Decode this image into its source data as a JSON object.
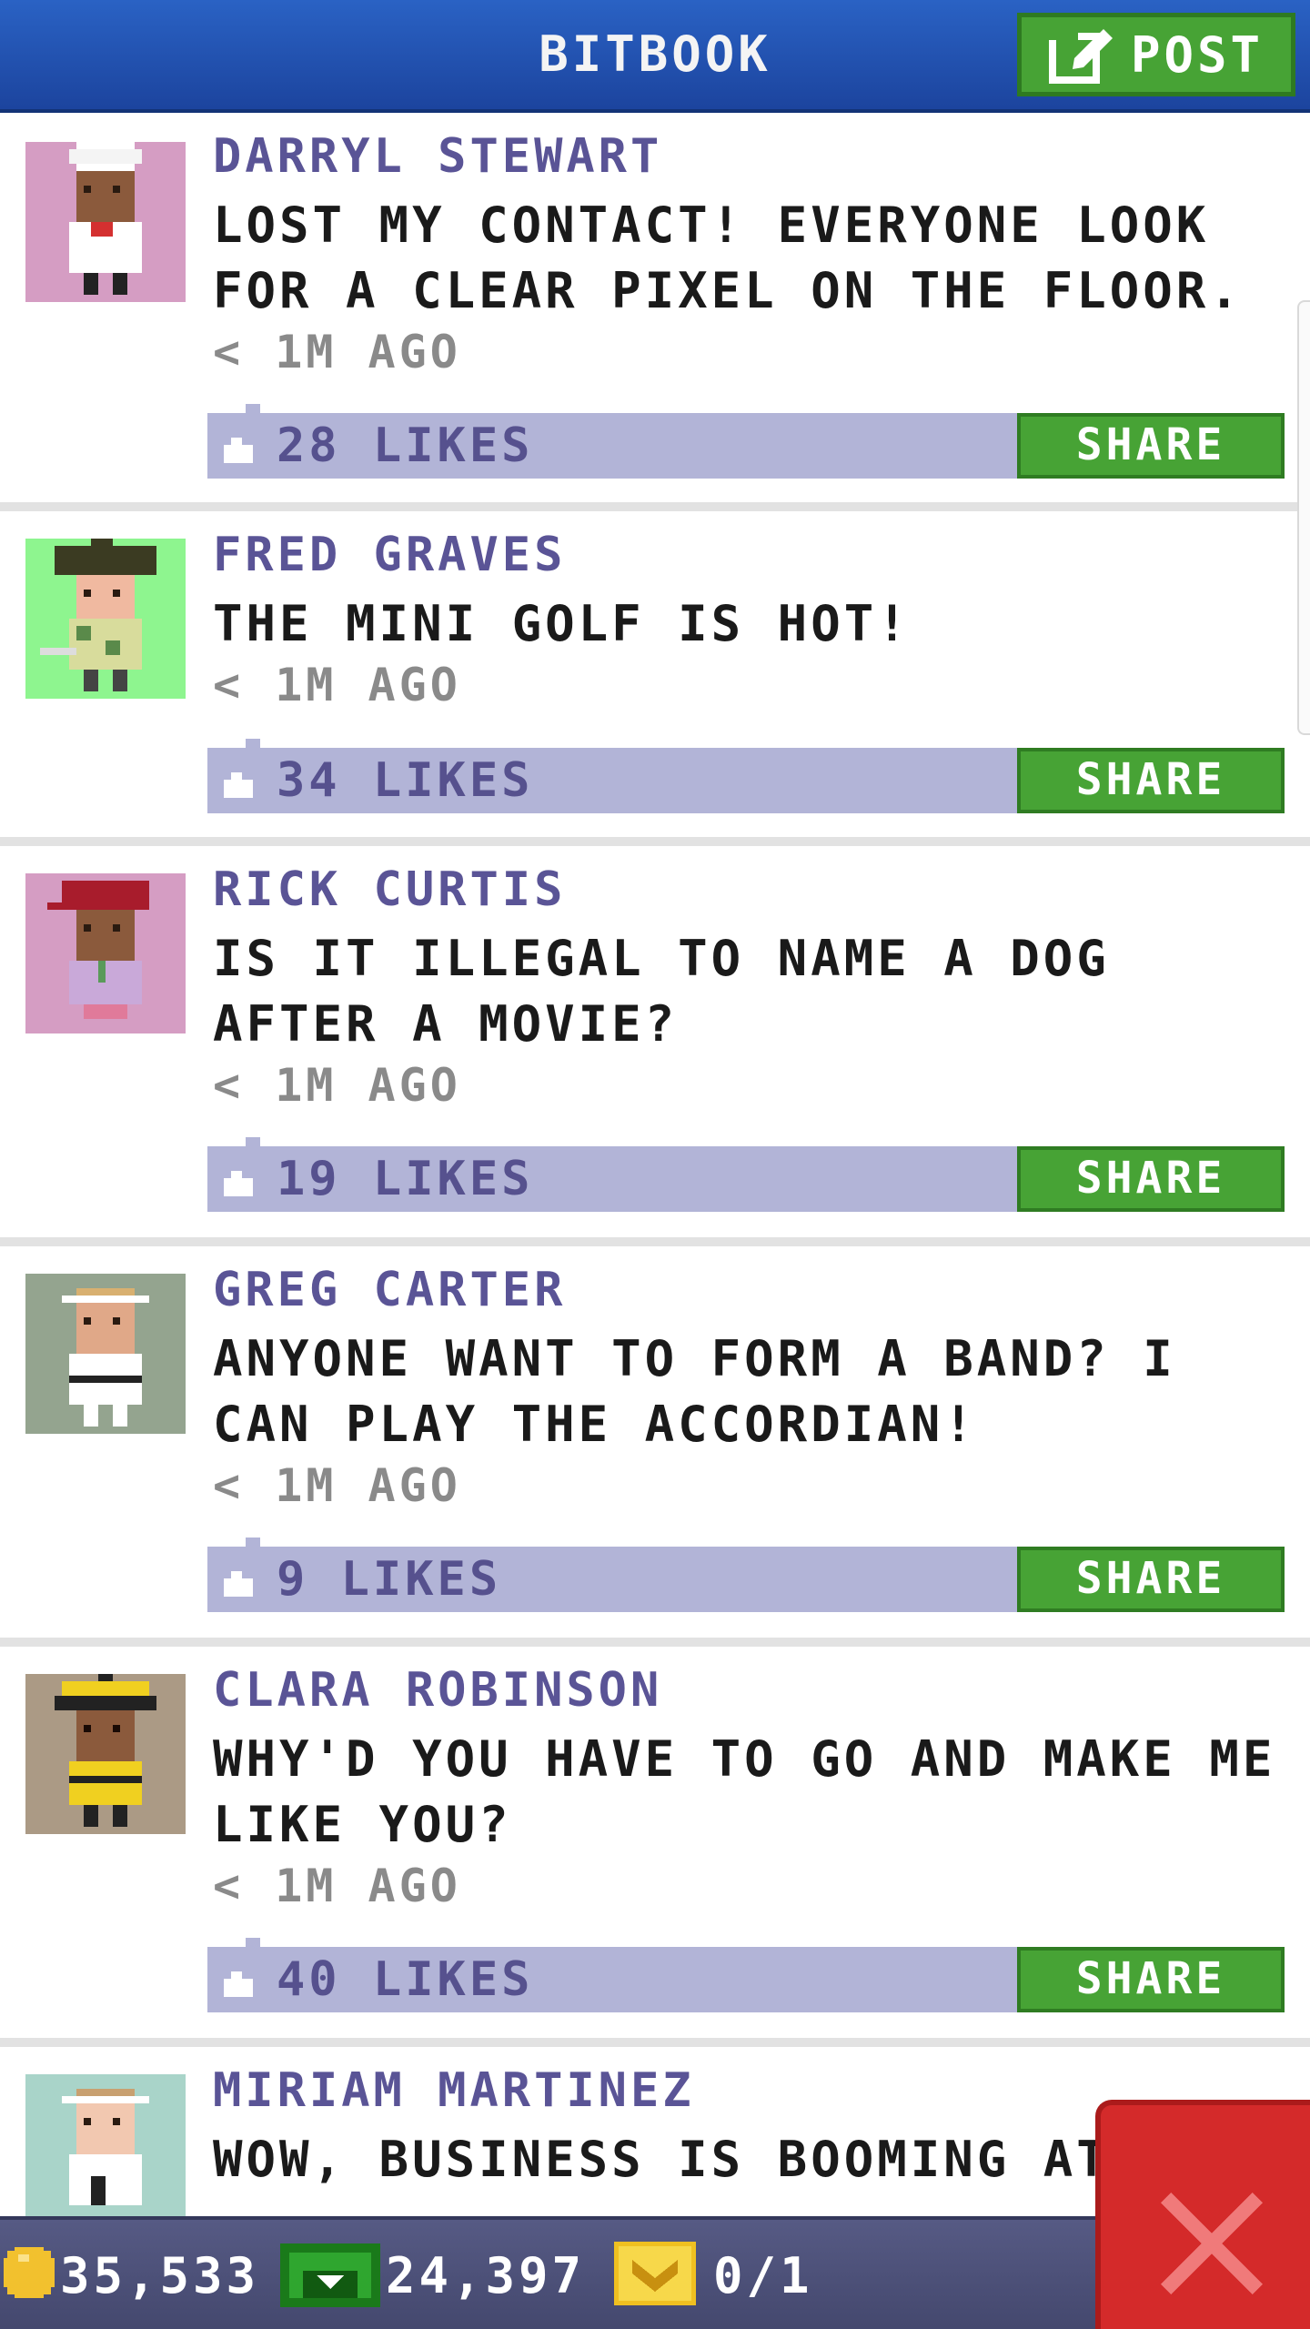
{
  "header": {
    "title": "BITBOOK",
    "post_label": "POST"
  },
  "posts": [
    {
      "name": "DARRYL STEWART",
      "message": "LOST MY CONTACT! EVERYONE LOOK FOR A CLEAR PIXEL ON THE FLOOR.",
      "time": "< 1M AGO",
      "likes": "28 LIKES",
      "share_label": "SHARE",
      "avatar_bg": "#d59dc3"
    },
    {
      "name": "FRED GRAVES",
      "message": "THE MINI GOLF IS HOT!",
      "time": "< 1M AGO",
      "likes": "34 LIKES",
      "share_label": "SHARE",
      "avatar_bg": "#8ef58f"
    },
    {
      "name": "RICK CURTIS",
      "message": "IS IT ILLEGAL TO NAME A DOG AFTER A MOVIE?",
      "time": "< 1M AGO",
      "likes": "19 LIKES",
      "share_label": "SHARE",
      "avatar_bg": "#d59dc3"
    },
    {
      "name": "GREG CARTER",
      "message": "ANYONE WANT TO FORM A BAND? I CAN PLAY THE ACCORDIAN!",
      "time": "< 1M AGO",
      "likes": "9 LIKES",
      "share_label": "SHARE",
      "avatar_bg": "#94a48f"
    },
    {
      "name": "CLARA ROBINSON",
      "message": "WHY'D YOU HAVE TO GO AND MAKE ME LIKE YOU?",
      "time": "< 1M AGO",
      "likes": "40 LIKES",
      "share_label": "SHARE",
      "avatar_bg": "#ab9a85"
    },
    {
      "name": "MIRIAM MARTINEZ",
      "message": "WOW, BUSINESS IS BOOMING AT",
      "avatar_bg": "#a9d4c9"
    }
  ],
  "bottom_bar": {
    "coins": "35,533",
    "bux": "24,397",
    "vip": "0/1"
  },
  "colors": {
    "header_blue": "#2a62c4",
    "share_green": "#47a335",
    "likes_bar": "#b2b4d7",
    "name_purple": "#5a5496",
    "close_red": "#d42a2a"
  }
}
